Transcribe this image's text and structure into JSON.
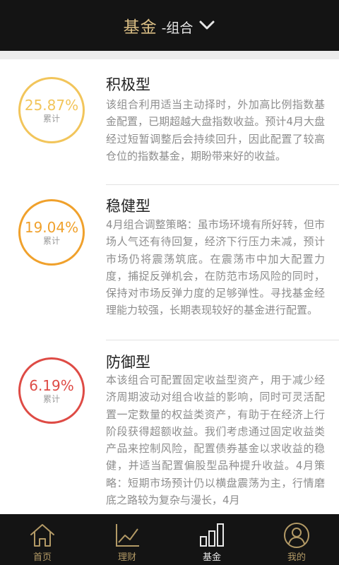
{
  "header": {
    "title": "基金",
    "subtitle": "-组合",
    "dropdown_icon": "chevron-down-icon"
  },
  "portfolios": [
    {
      "name": "积极型",
      "return_pct": "25.87%",
      "return_label": "累计",
      "ring_color": "#f2c55b",
      "description": "该组合利用适当主动择时，外加高比例指数基金配置，已期超越大盘指数收益。预计4月大盘经过短暂调整后会持续回升，因此配置了较高仓位的指数基金，期盼带来好的收益。"
    },
    {
      "name": "稳健型",
      "return_pct": "19.04%",
      "return_label": "累计",
      "ring_color": "#f0a12c",
      "description": "4月组合调整策略：虽市场环境有所好转，但市场人气还有待回复，经济下行压力未减，预计市场仍将震荡筑底。在震荡市中加大配置力度，捕捉反弹机会，在防范市场风险的同时，保持对市场反弹力度的足够弹性。寻找基金经理能力较强，长期表现较好的基金进行配置。"
    },
    {
      "name": "防御型",
      "return_pct": "6.19%",
      "return_label": "累计",
      "ring_color": "#de4b45",
      "description": "本该组合可配置固定收益型资产，用于减少经济周期波动对组合收益的影响，同时可灵活配置一定数量的权益类资产，有助于在经济上行阶段获得超额收益。我们考虑通过固定收益类产品来控制风险，配置债券基金以求收益的稳健，并适当配置偏股型品种提升收益。4月策略：短期市场预计仍以横盘震荡为主，行情磨底之路较为复杂与漫长，4月"
    }
  ],
  "tabbar": {
    "tabs": [
      {
        "label": "首页",
        "icon": "home-icon",
        "active": false
      },
      {
        "label": "理财",
        "icon": "chart-line-icon",
        "active": false
      },
      {
        "label": "基金",
        "icon": "bar-chart-icon",
        "active": true
      },
      {
        "label": "我的",
        "icon": "user-icon",
        "active": false
      }
    ]
  },
  "colors": {
    "header_bg": "#141414",
    "accent_gold": "#d9bd84",
    "tab_inactive": "#b39a66"
  }
}
